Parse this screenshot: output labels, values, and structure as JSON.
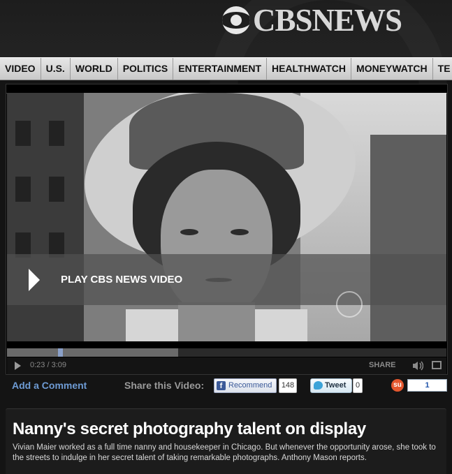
{
  "header": {
    "logo_text": "CBSNEWS"
  },
  "nav": {
    "items": [
      "VIDEO",
      "U.S.",
      "WORLD",
      "POLITICS",
      "ENTERTAINMENT",
      "HEALTHWATCH",
      "MONEYWATCH",
      "TE"
    ]
  },
  "player": {
    "play_label": "PLAY CBS NEWS VIDEO",
    "time": "0:23 / 3:09",
    "share_label": "SHARE",
    "progress_played_fraction": 0.1217,
    "progress_loaded_fraction": 0.39
  },
  "social": {
    "add_comment": "Add a Comment",
    "share_video": "Share this Video:",
    "facebook": {
      "label": "Recommend",
      "count": "148"
    },
    "twitter": {
      "label": "Tweet",
      "count": "0"
    },
    "stumbleupon": {
      "count": "1"
    }
  },
  "article": {
    "headline": "Nanny's secret photography talent on display",
    "summary": "Vivian Maier worked as a full time nanny and housekeeper in Chicago. But whenever the opportunity arose, she took to the streets to indulge in her secret talent of taking remarkable photographs. Anthony Mason reports."
  },
  "colors": {
    "link_blue": "#6e9bd4",
    "facebook_blue": "#3b5998",
    "twitter_blue": "#3ca3d8",
    "stumble_orange": "#e4572e"
  }
}
